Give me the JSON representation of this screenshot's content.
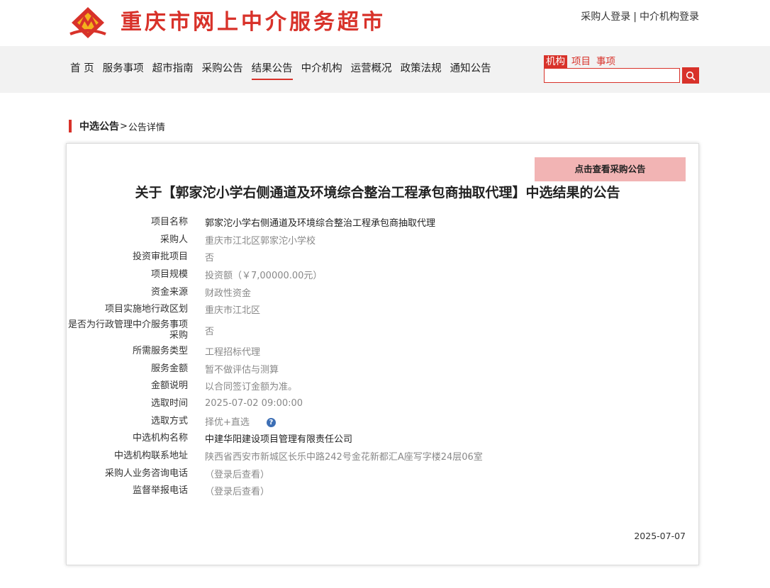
{
  "header": {
    "site_title": "重庆市网上中介服务超市",
    "purchaser_login": "采购人登录",
    "separator": "|",
    "agency_login": "中介机构登录"
  },
  "nav": {
    "items": [
      "首 页",
      "服务事项",
      "超市指南",
      "采购公告",
      "结果公告",
      "中介机构",
      "运营概况",
      "政策法规",
      "通知公告"
    ],
    "active_index": 4
  },
  "search": {
    "tabs": [
      "机构",
      "项目",
      "事项"
    ],
    "active_tab": "机构",
    "value": ""
  },
  "breadcrumb": {
    "section": "中选公告",
    "arrow": ">",
    "current": "公告详情"
  },
  "announcement": {
    "view_purchase_button": "点击查看采购公告",
    "title": "关于【郭家沱小学右侧通道及环境综合整治工程承包商抽取代理】中选结果的公告",
    "date": "2025-07-07",
    "fields": [
      {
        "label": "项目名称",
        "value": "郭家沱小学右侧通道及环境综合整治工程承包商抽取代理"
      },
      {
        "label": "采购人",
        "value": "重庆市江北区郭家沱小学校"
      },
      {
        "label": "投资审批项目",
        "value": "否"
      },
      {
        "label": "项目规模",
        "value": "投资额（￥7,00000.00元）"
      },
      {
        "label": "资金来源",
        "value": "财政性资金"
      },
      {
        "label": "项目实施地行政区划",
        "value": "重庆市江北区"
      },
      {
        "label": "是否为行政管理中介服务事项采购",
        "value": "否"
      },
      {
        "label": "所需服务类型",
        "value": "工程招标代理"
      },
      {
        "label": "服务金额",
        "value": "暂不做评估与测算"
      },
      {
        "label": "金额说明",
        "value": "以合同签订金额为准。"
      },
      {
        "label": "选取时间",
        "value": "2025-07-02 09:00:00"
      },
      {
        "label": "选取方式",
        "value": "择优+直选"
      },
      {
        "label": "中选机构名称",
        "value": "中建华阳建设项目管理有限责任公司"
      },
      {
        "label": "中选机构联系地址",
        "value": "陕西省西安市新城区长乐中路242号金花新都汇A座写字楼24层06室"
      },
      {
        "label": "采购人业务咨询电话",
        "value": "（登录后查看）"
      },
      {
        "label": "监督举报电话",
        "value": "（登录后查看）"
      }
    ]
  },
  "colors": {
    "brand": "#d8322a",
    "button_bg": "#f2b4b4",
    "nav_bg": "#f2f2f2"
  }
}
